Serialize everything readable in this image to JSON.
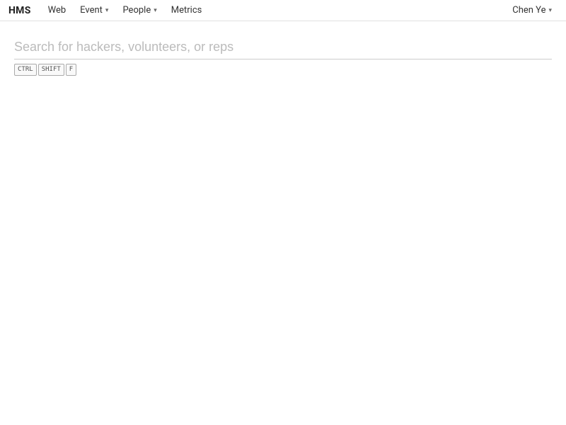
{
  "brand": "HMS",
  "nav": {
    "items": [
      {
        "label": "Web",
        "hasDropdown": false
      },
      {
        "label": "Event",
        "hasDropdown": true
      },
      {
        "label": "People",
        "hasDropdown": true
      },
      {
        "label": "Metrics",
        "hasDropdown": false
      }
    ],
    "user": {
      "name": "Chen Ye",
      "hasDropdown": true
    }
  },
  "search": {
    "placeholder": "Search for hackers, volunteers, or reps"
  },
  "keyboard_shortcut": {
    "keys": [
      "CTRL",
      "SHIFT",
      "F"
    ]
  }
}
